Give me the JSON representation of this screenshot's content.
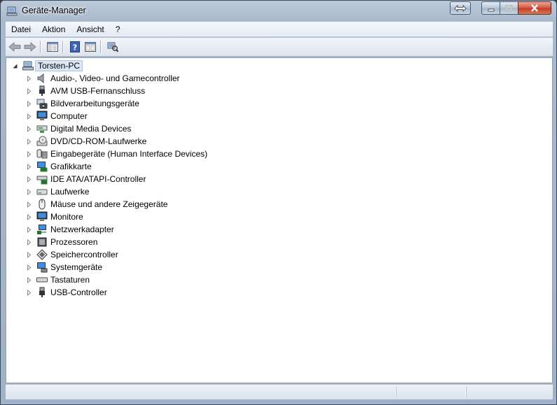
{
  "window": {
    "title": "Geräte-Manager"
  },
  "menubar": {
    "items": [
      "Datei",
      "Aktion",
      "Ansicht",
      "?"
    ]
  },
  "toolbar": {
    "buttons": [
      {
        "icon": "back-arrow-icon"
      },
      {
        "icon": "forward-arrow-icon"
      },
      {
        "icon": "console-tree-icon"
      },
      {
        "icon": "help-icon"
      },
      {
        "icon": "properties-view-icon"
      },
      {
        "icon": "scan-hardware-icon"
      }
    ]
  },
  "tree": {
    "root": {
      "label": "Torsten-PC",
      "expanded": true,
      "icon": "computer-icon"
    },
    "categories": [
      {
        "label": "Audio-, Video- und Gamecontroller",
        "icon": "speaker-icon"
      },
      {
        "label": "AVM USB-Fernanschluss",
        "icon": "usb-plug-icon"
      },
      {
        "label": "Bildverarbeitungsgeräte",
        "icon": "camera-icon"
      },
      {
        "label": "Computer",
        "icon": "monitor-icon"
      },
      {
        "label": "Digital Media Devices",
        "icon": "media-device-icon"
      },
      {
        "label": "DVD/CD-ROM-Laufwerke",
        "icon": "dvd-drive-icon"
      },
      {
        "label": "Eingabegeräte (Human Interface Devices)",
        "icon": "hid-icon"
      },
      {
        "label": "Grafikkarte",
        "icon": "display-adapter-icon"
      },
      {
        "label": "IDE ATA/ATAPI-Controller",
        "icon": "ide-controller-icon"
      },
      {
        "label": "Laufwerke",
        "icon": "disk-drive-icon"
      },
      {
        "label": "Mäuse und andere Zeigegeräte",
        "icon": "mouse-icon"
      },
      {
        "label": "Monitore",
        "icon": "monitor-icon"
      },
      {
        "label": "Netzwerkadapter",
        "icon": "network-adapter-icon"
      },
      {
        "label": "Prozessoren",
        "icon": "processor-icon"
      },
      {
        "label": "Speichercontroller",
        "icon": "storage-controller-icon"
      },
      {
        "label": "Systemgeräte",
        "icon": "system-device-icon"
      },
      {
        "label": "Tastaturen",
        "icon": "keyboard-icon"
      },
      {
        "label": "USB-Controller",
        "icon": "usb-plug-icon"
      }
    ]
  },
  "colors": {
    "selection": "#dbe7f5",
    "close_button": "#c23a22"
  }
}
